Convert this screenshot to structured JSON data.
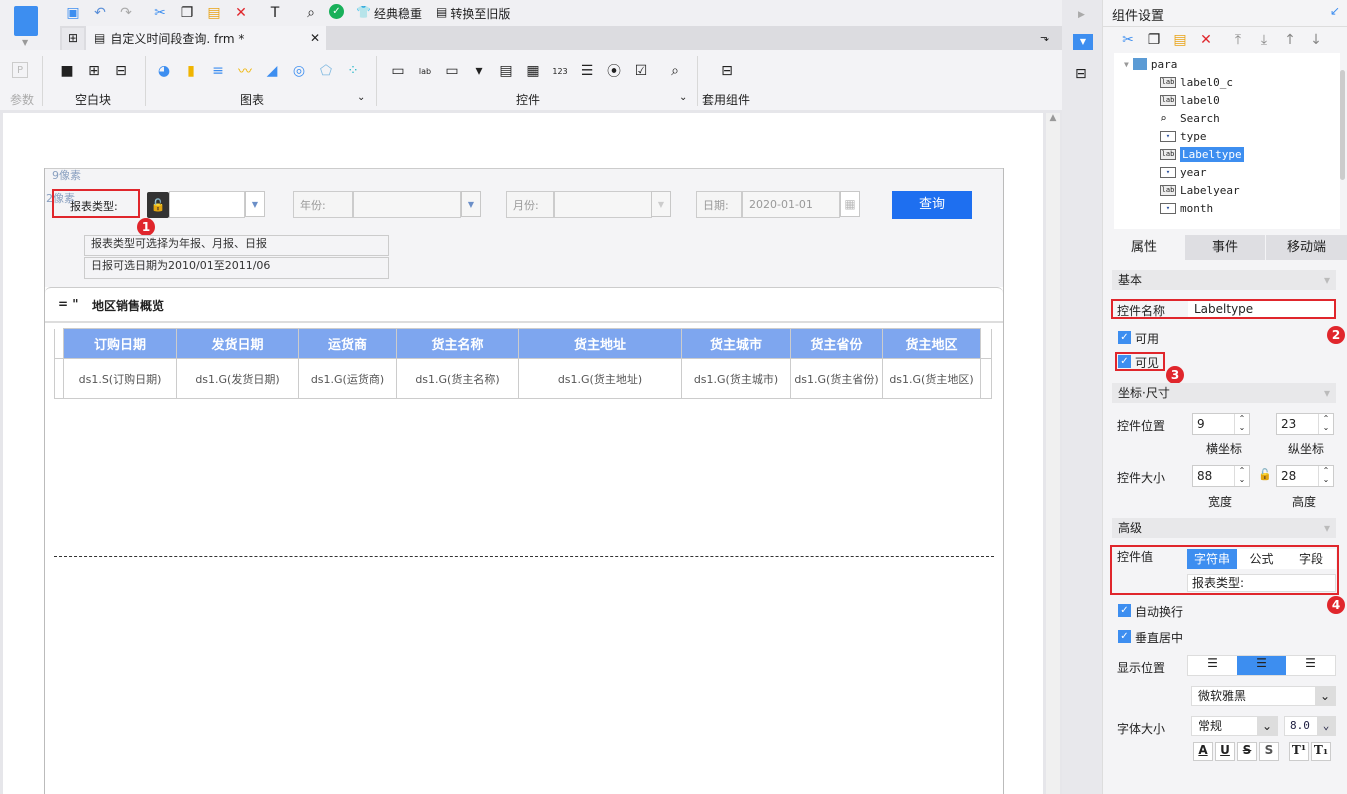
{
  "toolbar": {
    "classic": "经典稳重",
    "convert": "转换至旧版"
  },
  "tab": {
    "title": "自定义时间段查询. frm *"
  },
  "ribbon": {
    "params": "参数",
    "blank": "空白块",
    "chart": "图表",
    "widgets": "控件",
    "templates": "套用组件"
  },
  "form": {
    "hint_top": "9像素",
    "hint_left": "2像素",
    "label_type": "报表类型:",
    "label_year": "年份:",
    "label_month": "月份:",
    "label_date": "日期:",
    "date_value": "2020-01-01",
    "query_button": "查询",
    "note1": "报表类型可选择为年报、月报、日报",
    "note2": "日报可选日期为2010/01至2011/06",
    "report_title": "地区销售概览",
    "title_prefix": "= \""
  },
  "table": {
    "headers": [
      "订购日期",
      "发货日期",
      "运货商",
      "货主名称",
      "货主地址",
      "货主城市",
      "货主省份",
      "货主地区"
    ],
    "cells": [
      "ds1.S(订购日期)",
      "ds1.G(发货日期)",
      "ds1.G(运货商)",
      "ds1.G(货主名称)",
      "ds1.G(货主地址)",
      "ds1.G(货主城市)",
      "ds1.G(货主省份)",
      "ds1.G(货主地区)"
    ]
  },
  "panel": {
    "title": "组件设置",
    "tree": [
      {
        "name": "para",
        "icon": "para"
      },
      {
        "name": "label0_c",
        "icon": "lab"
      },
      {
        "name": "label0",
        "icon": "lab"
      },
      {
        "name": "Search",
        "icon": "search"
      },
      {
        "name": "type",
        "icon": "combo"
      },
      {
        "name": "Labeltype",
        "icon": "lab",
        "selected": true
      },
      {
        "name": "year",
        "icon": "combo"
      },
      {
        "name": "Labelyear",
        "icon": "lab"
      },
      {
        "name": "month",
        "icon": "combo"
      }
    ],
    "tabs": [
      "属性",
      "事件",
      "移动端"
    ],
    "basic": "基本",
    "name_label": "控件名称",
    "name_value": "Labeltype",
    "enabled": "可用",
    "visible": "可见",
    "coord": "坐标·尺寸",
    "pos_label": "控件位置",
    "x": "9",
    "y": "23",
    "x_label": "横坐标",
    "y_label": "纵坐标",
    "size_label": "控件大小",
    "w": "88",
    "h": "28",
    "w_label": "宽度",
    "h_label": "高度",
    "advanced": "高级",
    "value_label": "控件值",
    "value_tabs": [
      "字符串",
      "公式",
      "字段"
    ],
    "value": "报表类型:",
    "autowrap": "自动换行",
    "vcenter": "垂直居中",
    "align_label": "显示位置",
    "font": "微软雅黑",
    "fontsize_label": "字体大小",
    "style": "常规",
    "size": "8.0"
  },
  "badges": [
    "1",
    "2",
    "3",
    "4"
  ],
  "colors": {
    "accent": "#3d8ef0",
    "header": "#7ea6ef",
    "highlight": "#e0262c"
  }
}
